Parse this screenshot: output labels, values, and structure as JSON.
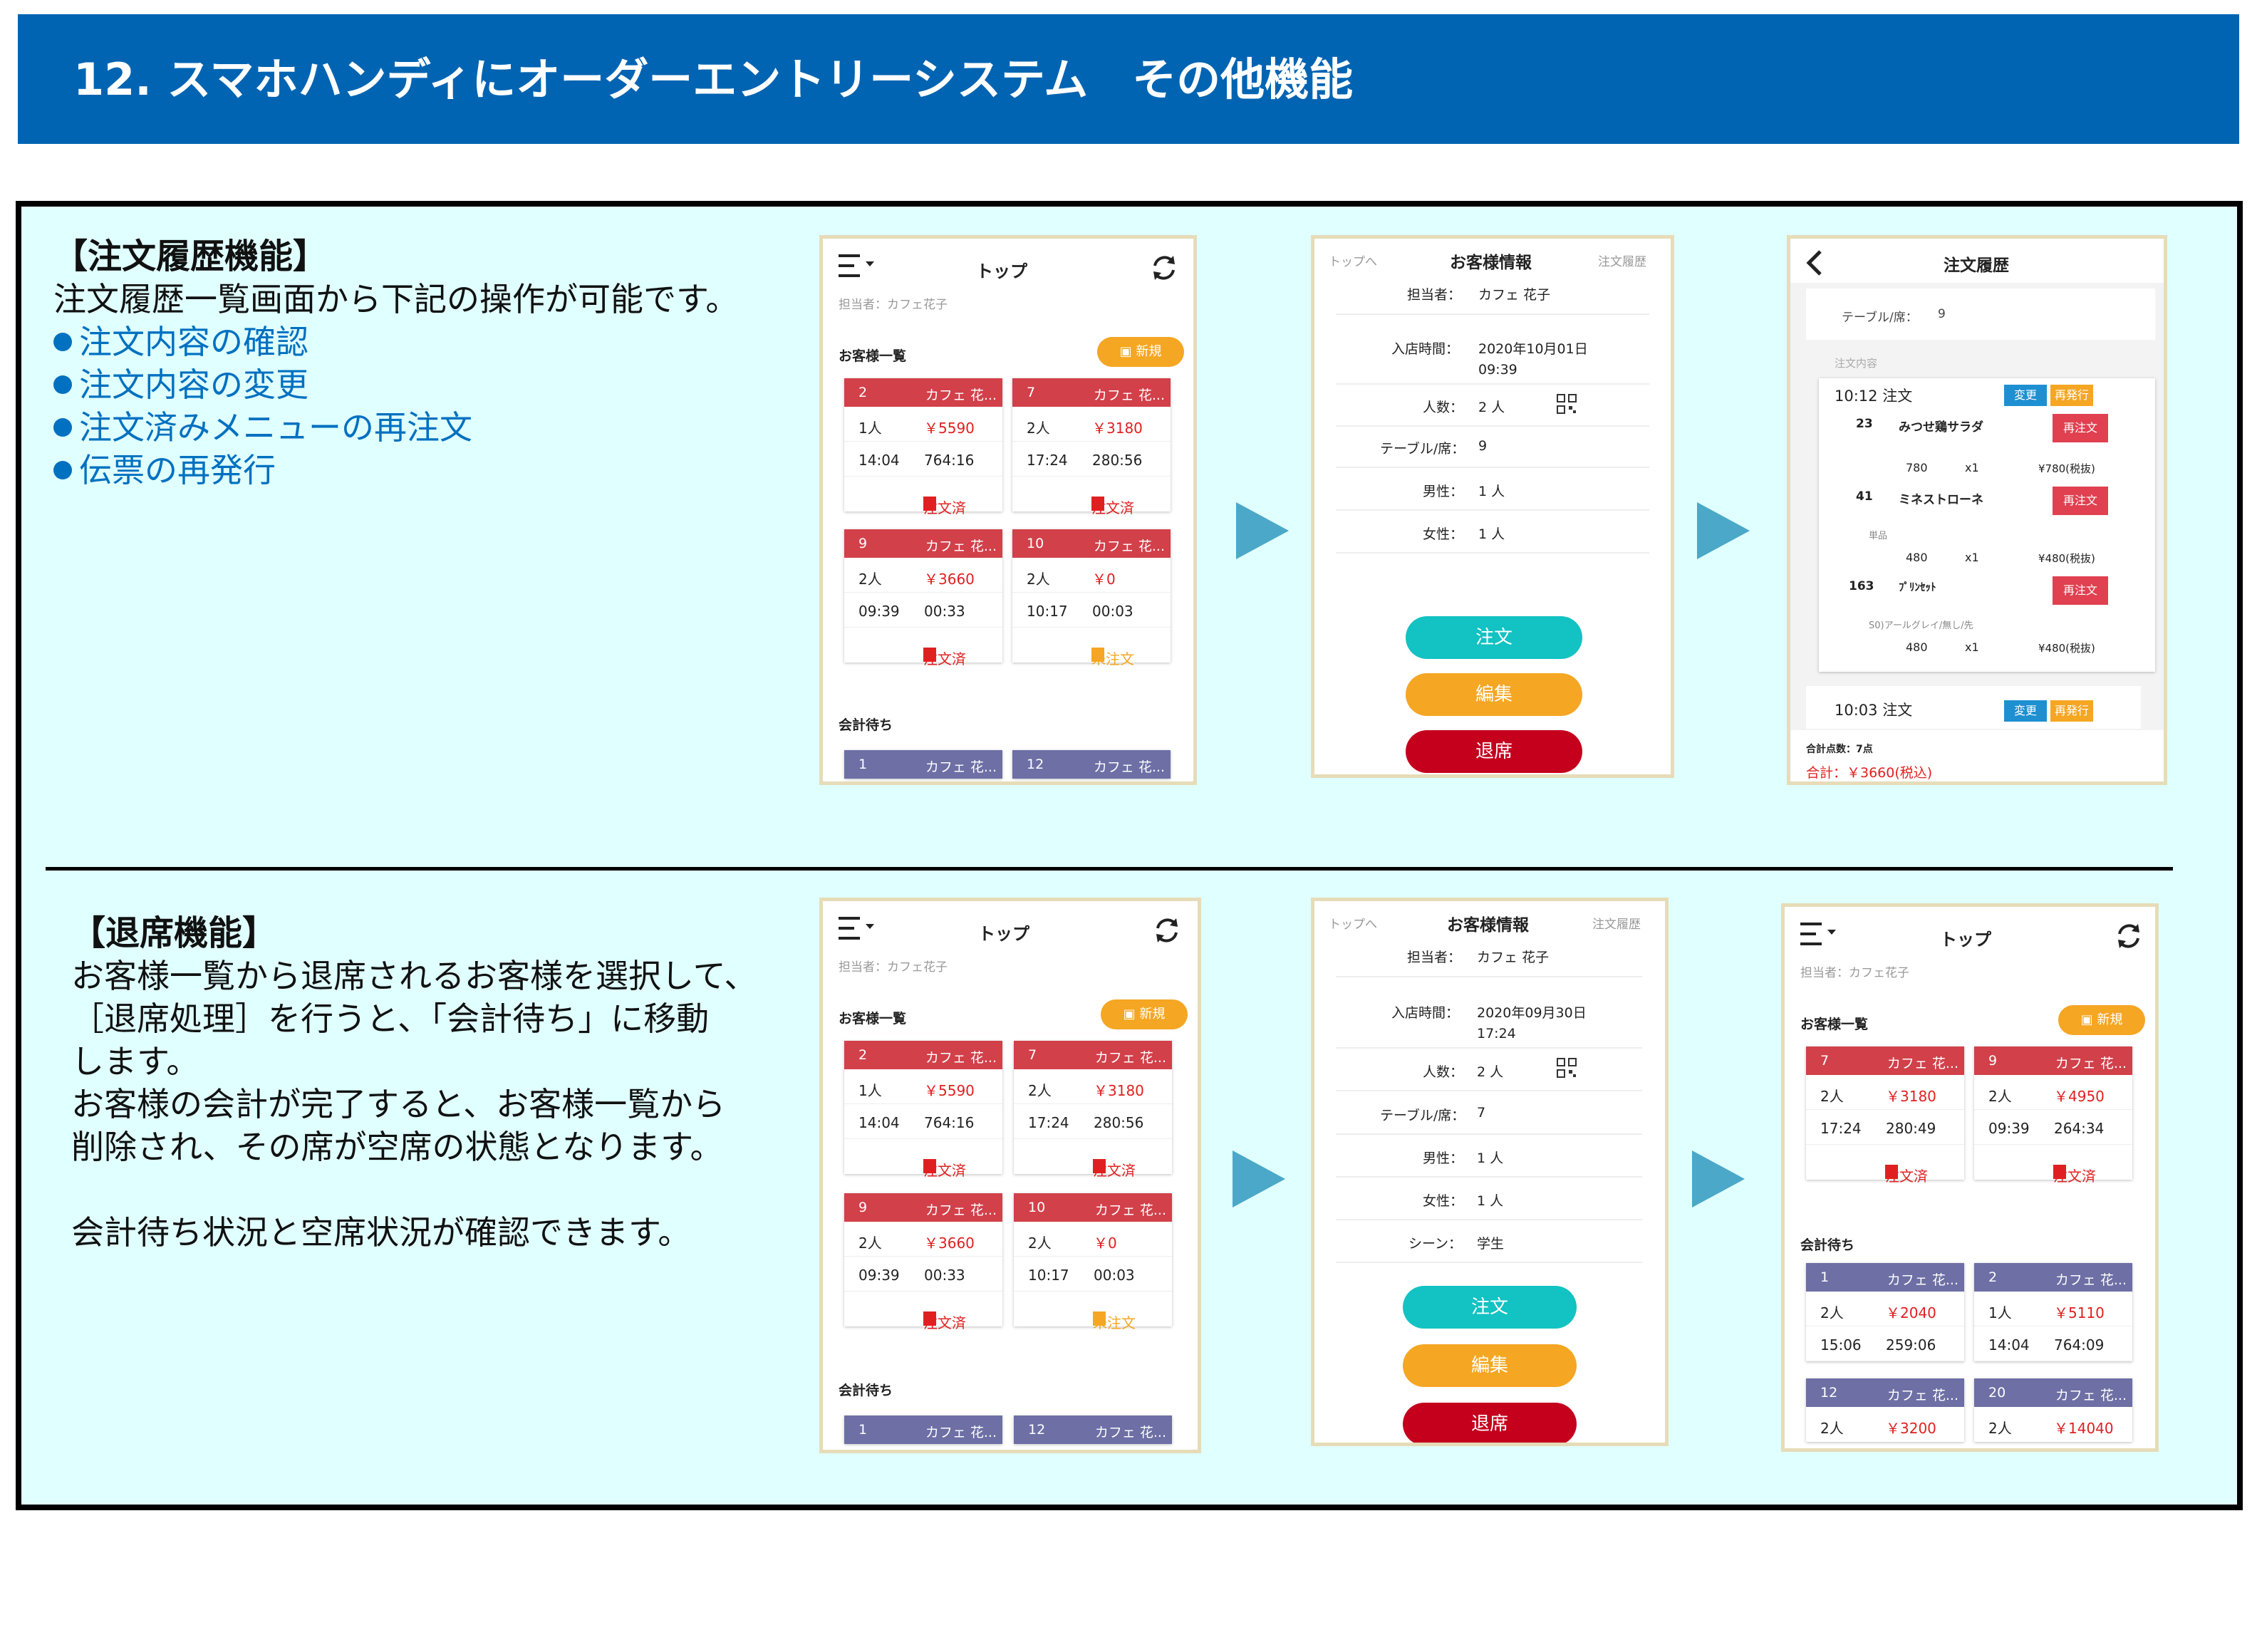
{
  "header": {
    "title": "12. スマホハンディにオーダーエントリーシステム　その他機能"
  },
  "colors": {
    "header_bg": "#0064B2",
    "box_bg": "#E0FFFF",
    "accent_red": "#D2404A",
    "accent_purple": "#6D6FA5",
    "accent_orange": "#F5A623",
    "accent_teal": "#13C2C2",
    "arrow": "#4BA8C8"
  },
  "section1": {
    "heading": "【注文履歴機能】",
    "intro": "注文履歴一覧画面から下記の操作が可能です。",
    "bullets": [
      "注文内容の確認",
      "注文内容の変更",
      "注文済みメニューの再注文",
      "伝票の再発行"
    ]
  },
  "section2": {
    "heading": "【退席機能】",
    "lines": [
      "お客様一覧から退席されるお客様を選択して、",
      "［退席処理］を行うと、「会計待ち」に移動",
      "します。",
      "お客様の会計が完了すると、お客様一覧から",
      "削除され、その席が空席の状態となります。",
      "",
      "会計待ち状況と空席状況が確認できます。"
    ]
  },
  "top_screen": {
    "title": "トップ",
    "staff": "担当者：カフェ花子",
    "customers_label": "お客様一覧",
    "new_label": "新規",
    "waiting_label": "会計待ち",
    "ordered": "注文済",
    "not_ordered": "未注文"
  },
  "screen_a": {
    "cards": [
      {
        "num": "2",
        "name": "カフェ 花...",
        "people": "1人",
        "price": "￥5590",
        "time": "14:04",
        "elapsed": "764:16",
        "status": "注文済"
      },
      {
        "num": "7",
        "name": "カフェ 花...",
        "people": "2人",
        "price": "￥3180",
        "time": "17:24",
        "elapsed": "280:56",
        "status": "注文済"
      },
      {
        "num": "9",
        "name": "カフェ 花...",
        "people": "2人",
        "price": "￥3660",
        "time": "09:39",
        "elapsed": "00:33",
        "status": "注文済"
      },
      {
        "num": "10",
        "name": "カフェ 花...",
        "people": "2人",
        "price": "￥0",
        "time": "10:17",
        "elapsed": "00:03",
        "status": "未注文"
      }
    ],
    "waiting": [
      {
        "num": "1",
        "name": "カフェ 花..."
      },
      {
        "num": "12",
        "name": "カフェ 花..."
      }
    ]
  },
  "screen_b": {
    "back": "トップへ",
    "title": "お客様情報",
    "history": "注文履歴",
    "fields": [
      {
        "label": "担当者：",
        "value": "カフェ 花子"
      },
      {
        "label": "入店時間：",
        "value": "2020年10月01日",
        "value2": "09:39"
      },
      {
        "label": "人数：",
        "value": "2 人"
      },
      {
        "label": "テーブル/席：",
        "value": "9"
      },
      {
        "label": "男性：",
        "value": "1 人"
      },
      {
        "label": "女性：",
        "value": "1 人"
      }
    ],
    "buttons": [
      "注文",
      "編集",
      "退席"
    ]
  },
  "screen_c": {
    "title": "注文履歴",
    "table_label": "テーブル/席：",
    "table_value": "9",
    "contents_label": "注文内容",
    "order1_time": "10:12 注文",
    "change": "変更",
    "reissue": "再発行",
    "reorder": "再注文",
    "items": [
      {
        "code": "23",
        "name": "みつせ鶏サラダ",
        "note": "",
        "price": "780",
        "qty": "x1",
        "total": "¥780(税抜)"
      },
      {
        "code": "41",
        "name": "ミネストローネ",
        "note": "単品",
        "price": "480",
        "qty": "x1",
        "total": "¥480(税抜)"
      },
      {
        "code": "163",
        "name": "ﾌﾟﾘﾝｾｯﾄ",
        "note": "S0)アールグレイ/無し/先",
        "price": "480",
        "qty": "x1",
        "total": "¥480(税抜)"
      }
    ],
    "order2_time": "10:03 注文",
    "count": "合計点数：7点",
    "total": "合計：￥3660(税込)"
  },
  "screen_d": {
    "cards": [
      {
        "num": "2",
        "name": "カフェ 花...",
        "people": "1人",
        "price": "￥5590",
        "time": "14:04",
        "elapsed": "764:16",
        "status": "注文済"
      },
      {
        "num": "7",
        "name": "カフェ 花...",
        "people": "2人",
        "price": "￥3180",
        "time": "17:24",
        "elapsed": "280:56",
        "status": "注文済"
      },
      {
        "num": "9",
        "name": "カフェ 花...",
        "people": "2人",
        "price": "￥3660",
        "time": "09:39",
        "elapsed": "00:33",
        "status": "注文済"
      },
      {
        "num": "10",
        "name": "カフェ 花...",
        "people": "2人",
        "price": "￥0",
        "time": "10:17",
        "elapsed": "00:03",
        "status": "未注文"
      }
    ],
    "waiting": [
      {
        "num": "1",
        "name": "カフェ 花..."
      },
      {
        "num": "12",
        "name": "カフェ 花..."
      }
    ]
  },
  "screen_e": {
    "back": "トップへ",
    "title": "お客様情報",
    "history": "注文履歴",
    "fields": [
      {
        "label": "担当者：",
        "value": "カフェ 花子"
      },
      {
        "label": "入店時間：",
        "value": "2020年09月30日",
        "value2": "17:24"
      },
      {
        "label": "人数：",
        "value": "2 人"
      },
      {
        "label": "テーブル/席：",
        "value": "7"
      },
      {
        "label": "男性：",
        "value": "1 人"
      },
      {
        "label": "女性：",
        "value": "1 人"
      },
      {
        "label": "シーン：",
        "value": "学生"
      }
    ],
    "buttons": [
      "注文",
      "編集",
      "退席"
    ]
  },
  "screen_f": {
    "cards": [
      {
        "num": "7",
        "name": "カフェ 花...",
        "people": "2人",
        "price": "￥3180",
        "time": "17:24",
        "elapsed": "280:49",
        "status": "注文済"
      },
      {
        "num": "9",
        "name": "カフェ 花...",
        "people": "2人",
        "price": "￥4950",
        "time": "09:39",
        "elapsed": "264:34",
        "status": "注文済"
      }
    ],
    "waiting": [
      {
        "num": "1",
        "name": "カフェ 花...",
        "people": "2人",
        "price": "￥2040",
        "time": "15:06",
        "elapsed": "259:06"
      },
      {
        "num": "2",
        "name": "カフェ 花...",
        "people": "1人",
        "price": "￥5110",
        "time": "14:04",
        "elapsed": "764:09"
      },
      {
        "num": "12",
        "name": "カフェ 花...",
        "people": "2人",
        "price": "￥3200"
      },
      {
        "num": "20",
        "name": "カフェ 花...",
        "people": "2人",
        "price": "￥14040"
      }
    ]
  }
}
